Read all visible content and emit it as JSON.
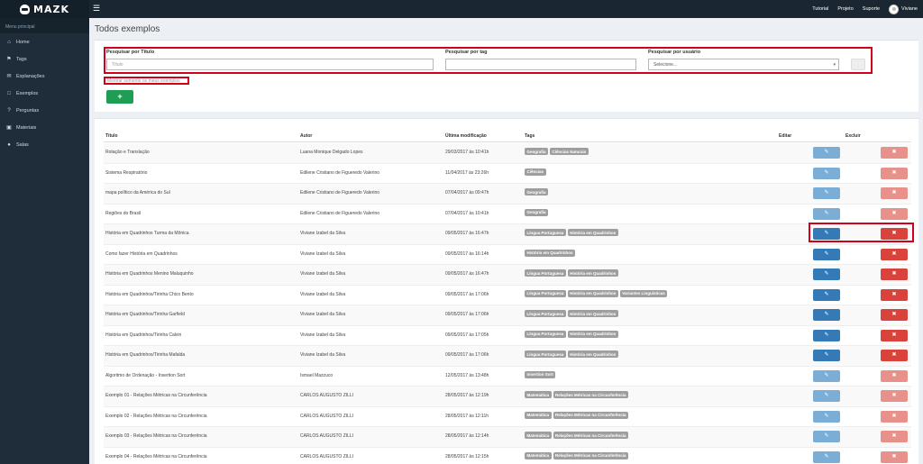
{
  "app": {
    "name": "MAZK"
  },
  "topnav": {
    "items": [
      "Tutorial",
      "Projeto",
      "Suporte"
    ],
    "user": "Viviane"
  },
  "sidebar": {
    "header": "Menu principal",
    "items": [
      {
        "label": "Home",
        "icon": "home-icon"
      },
      {
        "label": "Tags",
        "icon": "tag-icon"
      },
      {
        "label": "Explanações",
        "icon": "comments-icon"
      },
      {
        "label": "Exemplos",
        "icon": "file-icon"
      },
      {
        "label": "Perguntas",
        "icon": "question-icon"
      },
      {
        "label": "Materiais",
        "icon": "folder-icon"
      },
      {
        "label": "Salas",
        "icon": "users-icon"
      }
    ]
  },
  "page": {
    "title": "Todos exemplos"
  },
  "search": {
    "title_label": "Pesquisar por Título",
    "title_placeholder": "Título",
    "tag_label": "Pesquisar por tag",
    "user_label": "Pesquisar por usuário",
    "user_select": "Selecione...",
    "my_examples": "Mostrar somente os meus exemplos",
    "add_label": "+"
  },
  "table": {
    "headers": [
      "Título",
      "Autor",
      "Última modificação",
      "Tags",
      "Editar",
      "Excluir"
    ],
    "rows": [
      {
        "title": "Rotação e Translação",
        "author": "Luana Monique Delgado Lopes",
        "modified": "29/03/2017 às 10:41h",
        "tags": [
          "Geografia",
          "Ciências Naturais"
        ],
        "own": false
      },
      {
        "title": "Sistema Respiratório",
        "author": "Edilene Cristiano de Figueredo Valerino",
        "modified": "11/04/2017 às 23:26h",
        "tags": [
          "Ciências"
        ],
        "own": false
      },
      {
        "title": "mapa político da América do Sul",
        "author": "Edilene Cristiano de Figueredo Valerino",
        "modified": "07/04/2017 às 09:47h",
        "tags": [
          "Geografia"
        ],
        "own": false
      },
      {
        "title": "Regiões do Brasil",
        "author": "Edilene Cristiano de Figueredo Valerino",
        "modified": "07/04/2017 às 10:41h",
        "tags": [
          "Geografia"
        ],
        "own": false
      },
      {
        "title": "História em Quadrinhos Turma da Mônica",
        "author": "Viviane Izabel da Silva",
        "modified": "09/05/2017 às 16:47h",
        "tags": [
          "Língua Portuguesa",
          "História em Quadrinhos"
        ],
        "own": true
      },
      {
        "title": "Como fazer História em Quadrinhos",
        "author": "Viviane Izabel da Silva",
        "modified": "09/05/2017 às 16:14h",
        "tags": [
          "História em Quadrinhos"
        ],
        "own": true
      },
      {
        "title": "História em Quadrinhos Menino Maluquinho",
        "author": "Viviane Izabel da Silva",
        "modified": "09/05/2017 às 16:47h",
        "tags": [
          "Língua Portuguesa",
          "História em Quadrinhos"
        ],
        "own": true
      },
      {
        "title": "História em Quadrinhos/Tirinha Chico Bento",
        "author": "Viviane Izabel da Silva",
        "modified": "09/05/2017 às 17:06h",
        "tags": [
          "Língua Portuguesa",
          "História em Quadrinhos",
          "Variantes Linguísticas"
        ],
        "own": true
      },
      {
        "title": "História em Quadrinhos/Tirinha Garfield",
        "author": "Viviane Izabel da Silva",
        "modified": "09/05/2017 às 17:06h",
        "tags": [
          "Língua Portuguesa",
          "História em Quadrinhos"
        ],
        "own": true
      },
      {
        "title": "História em Quadrinhos/Tirinha Calvin",
        "author": "Viviane Izabel da Silva",
        "modified": "09/05/2017 às 17:05h",
        "tags": [
          "Língua Portuguesa",
          "História em Quadrinhos"
        ],
        "own": true
      },
      {
        "title": "História em Quadrinhos/Tirinha Mafalda",
        "author": "Viviane Izabel da Silva",
        "modified": "09/05/2017 às 17:06h",
        "tags": [
          "Língua Portuguesa",
          "História em Quadrinhos"
        ],
        "own": true
      },
      {
        "title": "Algoritmo de Ordenação - Insertion Sort",
        "author": "Ismael Mazzuco",
        "modified": "12/05/2017 às 13:48h",
        "tags": [
          "Insertion Sort"
        ],
        "own": false
      },
      {
        "title": "Exemplo 01 - Relações Métricas na Circunferência",
        "author": "CARLOS AUGUSTO ZILLI",
        "modified": "28/05/2017 às 12:19h",
        "tags": [
          "Matemática",
          "Relações Métricas na Circunferência"
        ],
        "own": false
      },
      {
        "title": "Exemplo 02 - Relações Métricas na Circunferência",
        "author": "CARLOS AUGUSTO ZILLI",
        "modified": "28/05/2017 às 12:11h",
        "tags": [
          "Matemática",
          "Relações Métricas na Circunferência"
        ],
        "own": false
      },
      {
        "title": "Exemplo 03 - Relações Métricas na Circunferência",
        "author": "CARLOS AUGUSTO ZILLI",
        "modified": "28/05/2017 às 12:14h",
        "tags": [
          "Matemática",
          "Relações Métricas na Circunferência"
        ],
        "own": false
      },
      {
        "title": "Exemplo 04 - Relações Métricas na Circunferência",
        "author": "CARLOS AUGUSTO ZILLI",
        "modified": "28/05/2017 às 12:15h",
        "tags": [
          "Matemática",
          "Relações Métricas na Circunferência"
        ],
        "own": false
      }
    ]
  }
}
